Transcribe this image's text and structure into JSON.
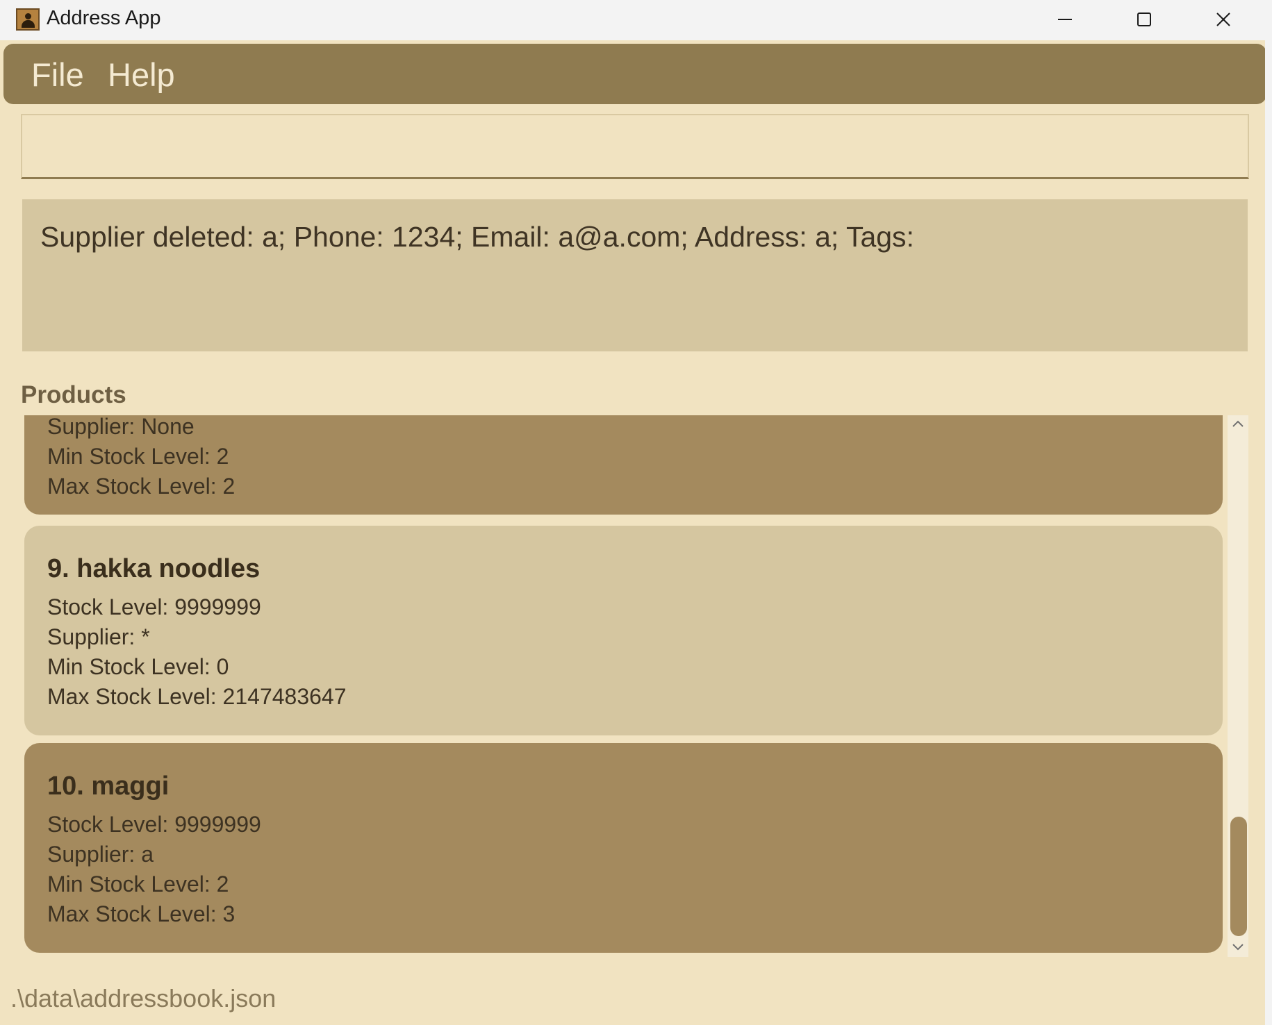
{
  "window": {
    "title": "Address App",
    "controls": [
      "minimize-icon",
      "maximize-icon",
      "close-icon"
    ]
  },
  "menu": {
    "items": [
      {
        "label": "File"
      },
      {
        "label": "Help"
      }
    ]
  },
  "command": {
    "value": "",
    "placeholder": ""
  },
  "result": {
    "text": "Supplier deleted: a; Phone: 1234; Email: a@a.com; Address: a; Tags:"
  },
  "products": {
    "heading": "Products",
    "cards": [
      {
        "title": "",
        "lines": [
          "Supplier: None",
          "Min Stock Level: 2",
          "Max Stock Level: 2"
        ]
      },
      {
        "title": "9. hakka noodles",
        "lines": [
          "Stock Level: 9999999",
          "Supplier: *",
          "Min Stock Level: 0",
          "Max Stock Level: 2147483647"
        ]
      },
      {
        "title": "10. maggi",
        "lines": [
          "Stock Level: 9999999",
          "Supplier: a",
          "Min Stock Level: 2",
          "Max Stock Level: 3"
        ]
      }
    ]
  },
  "status": {
    "path": ".\\data\\addressbook.json"
  },
  "colors": {
    "background": "#f1e3c1",
    "menubar": "#8f7b50",
    "card_dark": "#a48a5e",
    "card_light": "#d5c6a0"
  }
}
